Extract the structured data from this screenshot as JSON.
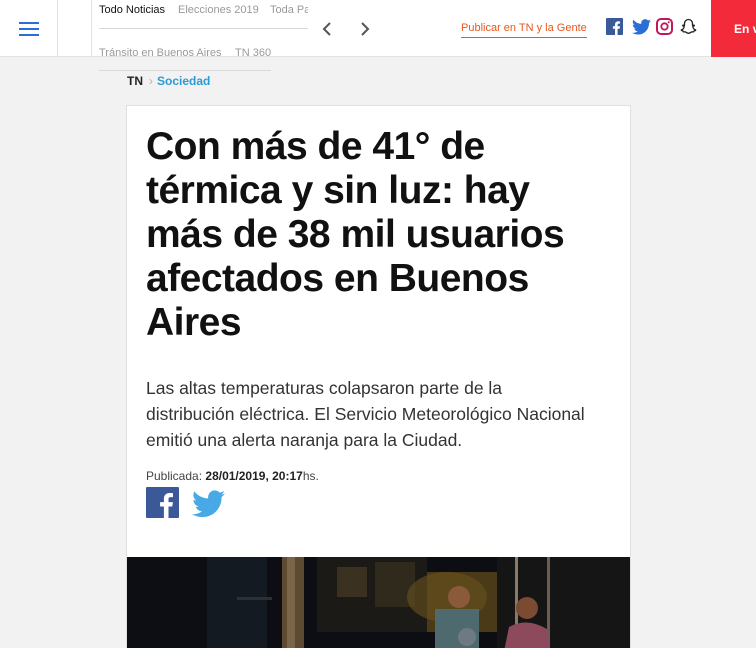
{
  "header": {
    "nav_row1": [
      "Todo Noticias",
      "Elecciones 2019",
      "Toda Pa"
    ],
    "nav_row2": [
      "Tránsito en Buenos Aires",
      "TN 360"
    ],
    "publish_label": "Publicar en TN y la Gente",
    "live_label": "En v",
    "social_icons": [
      "facebook-icon",
      "twitter-icon",
      "instagram-icon",
      "snapchat-icon"
    ],
    "colors": {
      "accent_blue": "#2a6fd6",
      "publish_orange": "#e8571e",
      "live_red": "#f22a3a"
    }
  },
  "breadcrumb": {
    "home": "TN",
    "separator": "›",
    "section": "Sociedad"
  },
  "article": {
    "title": "Con más de 41° de térmica y sin luz: hay más de 38 mil usuarios afectados en Buenos Aires",
    "lead": "Las altas temperaturas colapsaron parte de la distribución eléctrica. El Servicio Meteorológico Nacional emitió una alerta naranja para la Ciudad.",
    "published_label": "Publicada:",
    "published_datetime": "28/01/2019, 20:17",
    "published_suffix": "hs.",
    "share_icons": [
      "facebook-share-icon",
      "twitter-share-icon"
    ]
  }
}
